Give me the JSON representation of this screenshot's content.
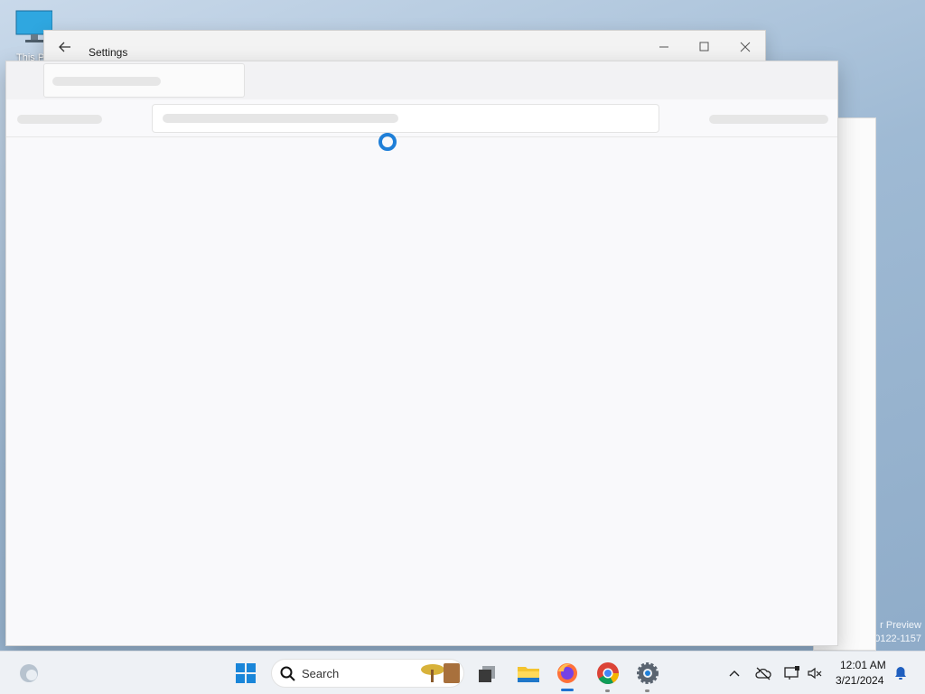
{
  "desktop": {
    "icon_label": "This PC",
    "watermark_line1": "r Preview",
    "watermark_line2": "0122-1157"
  },
  "settings_window": {
    "title": "Settings",
    "back_icon": "back-arrow-icon",
    "minimize_icon": "minimize-icon",
    "maximize_icon": "maximize-icon",
    "close_icon": "close-icon"
  },
  "loading_overlay": {
    "state": "loading",
    "spinner_icon": "loading-spinner-icon"
  },
  "taskbar": {
    "search_placeholder": "Search",
    "apps": [
      {
        "name": "start",
        "icon": "windows-start-icon"
      },
      {
        "name": "task-view",
        "icon": "task-view-icon"
      },
      {
        "name": "file-explorer",
        "icon": "folder-icon"
      },
      {
        "name": "firefox",
        "icon": "firefox-icon",
        "active": true
      },
      {
        "name": "chrome",
        "icon": "chrome-icon"
      },
      {
        "name": "settings",
        "icon": "gear-icon"
      }
    ],
    "tray": {
      "time": "12:01 AM",
      "date": "3/21/2024"
    }
  },
  "colors": {
    "accent": "#1f7fd8",
    "taskbar_bg": "#eef1f5"
  }
}
